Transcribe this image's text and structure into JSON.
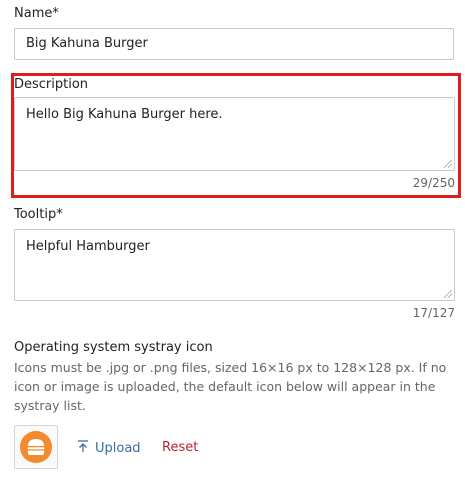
{
  "name_field": {
    "label": "Name*",
    "value": "Big Kahuna Burger"
  },
  "description_field": {
    "label": "Description",
    "value": "Hello Big Kahuna Burger here.",
    "counter": "29/250"
  },
  "tooltip_field": {
    "label": "Tooltip*",
    "value": "Helpful Hamburger",
    "counter": "17/127"
  },
  "systray": {
    "title": "Operating system systray icon",
    "help": "Icons must be .jpg or .png files, sized 16×16 px to 128×128 px. If no icon or image is uploaded, the default icon below will appear in the systray list.",
    "icon": "hamburger-icon",
    "upload_label": "Upload",
    "reset_label": "Reset"
  },
  "colors": {
    "highlight": "#e21b1b",
    "icon_bg": "#f28b2d",
    "upload": "#3a6ea5",
    "reset": "#b3262b"
  }
}
